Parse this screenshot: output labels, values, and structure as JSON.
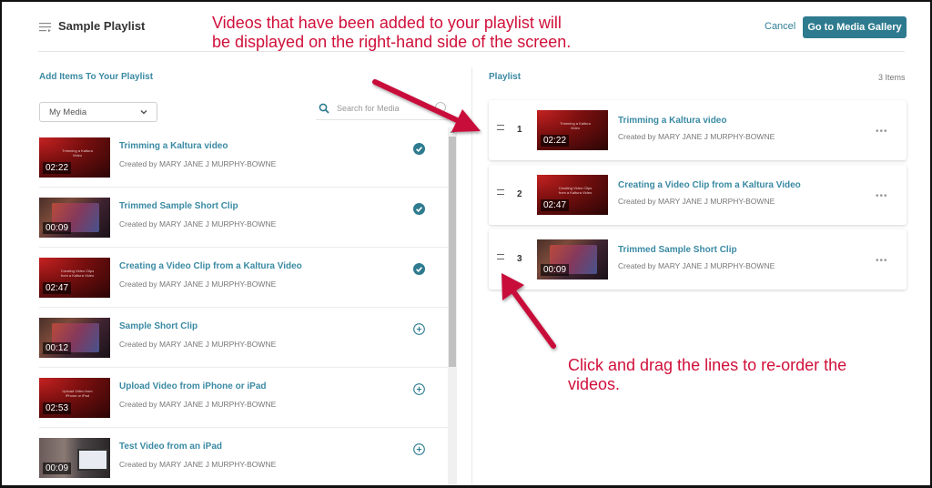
{
  "header": {
    "title": "Sample Playlist",
    "cancel_label": "Cancel",
    "gallery_label": "Go to Media Gallery"
  },
  "left": {
    "title": "Add Items To Your Playlist",
    "source_select": "My Media",
    "search_placeholder": "Search for Media",
    "items": [
      {
        "title": "Trimming a Kaltura video",
        "creator": "Created by MARY JANE J MURPHY-BOWNE",
        "duration": "02:22",
        "thumb_caption": "Trimming a Kaltura Video",
        "status": "added"
      },
      {
        "title": "Trimmed Sample Short Clip",
        "creator": "Created by MARY JANE J MURPHY-BOWNE",
        "duration": "00:09",
        "thumb_caption": "",
        "status": "added"
      },
      {
        "title": "Creating a Video Clip from a Kaltura Video",
        "creator": "Created by MARY JANE J MURPHY-BOWNE",
        "duration": "02:47",
        "thumb_caption": "Creating Video Clips from a Kaltura Video",
        "status": "added"
      },
      {
        "title": "Sample Short Clip",
        "creator": "Created by MARY JANE J MURPHY-BOWNE",
        "duration": "00:12",
        "thumb_caption": "",
        "status": "add"
      },
      {
        "title": "Upload Video from iPhone or iPad",
        "creator": "Created by MARY JANE J MURPHY-BOWNE",
        "duration": "02:53",
        "thumb_caption": "Upload Video from iPhone or iPad",
        "status": "add"
      },
      {
        "title": "Test Video from an iPad",
        "creator": "Created by MARY JANE J MURPHY-BOWNE",
        "duration": "00:09",
        "thumb_caption": "",
        "status": "add"
      }
    ]
  },
  "right": {
    "title": "Playlist",
    "count": "3 Items",
    "items": [
      {
        "index": "1",
        "title": "Trimming a Kaltura video",
        "creator": "Created by MARY JANE J MURPHY-BOWNE",
        "duration": "02:22",
        "thumb_caption": "Trimming a Kaltura Video"
      },
      {
        "index": "2",
        "title": "Creating a Video Clip from a Kaltura Video",
        "creator": "Created by MARY JANE J MURPHY-BOWNE",
        "duration": "02:47",
        "thumb_caption": "Creating Video Clips from a Kaltura Video"
      },
      {
        "index": "3",
        "title": "Trimmed Sample Short Clip",
        "creator": "Created by MARY JANE J MURPHY-BOWNE",
        "duration": "00:09",
        "thumb_caption": ""
      }
    ],
    "more_label": "•••"
  },
  "annotations": {
    "top": "Videos that have been added to your playlist will be displayed on the right-hand side of the screen.",
    "bottom": "Click and drag the lines to re-order the videos."
  },
  "colors": {
    "accent": "#2e7b8f",
    "link": "#3a8aa3",
    "annotation": "#d0103a"
  }
}
